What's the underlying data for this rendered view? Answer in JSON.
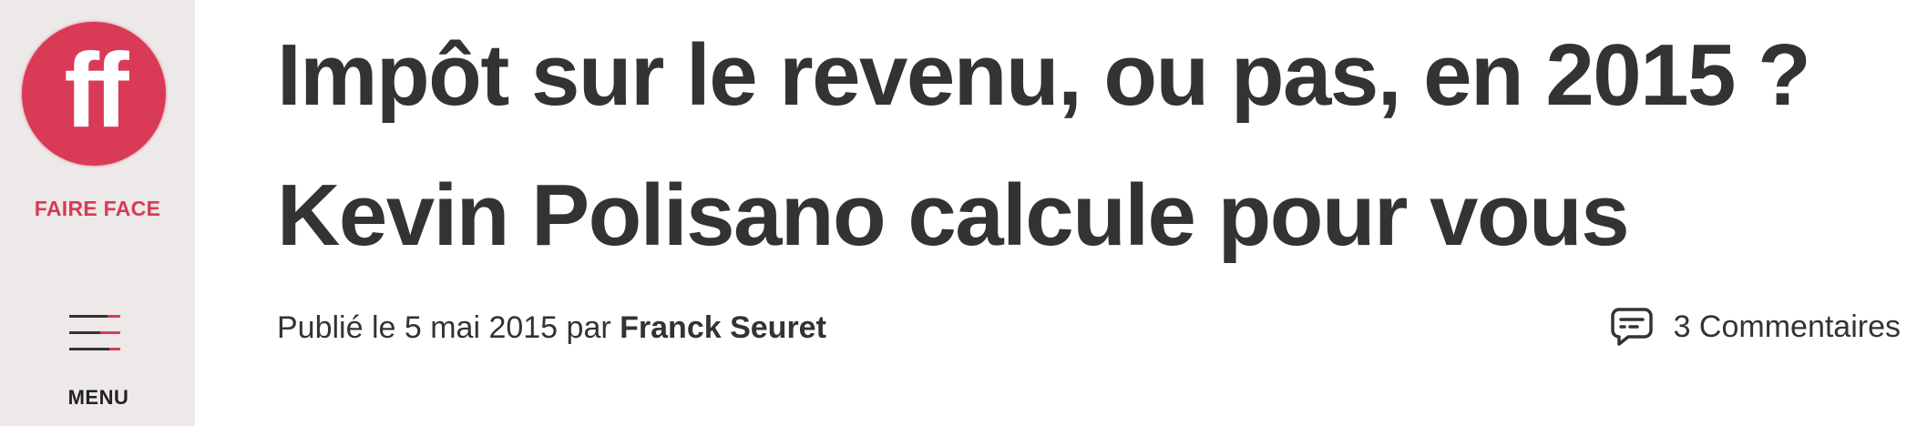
{
  "brand": {
    "logo_text": "ff",
    "name": "FAIRE FACE",
    "accent": "#d93a56"
  },
  "nav": {
    "menu_label": "MENU",
    "menu_icon": "hamburger-icon"
  },
  "article": {
    "title_line1": "Impôt sur le revenu, ou pas, en 2015 ?",
    "title_line2": "Kevin Polisano calcule pour vous",
    "published_prefix": "Publié le 5 mai 2015 par",
    "author": "Franck Seuret",
    "comments_icon": "comment-icon",
    "comments_label": "3 Commentaires"
  },
  "colors": {
    "sidebar_bg": "#ece9e8",
    "text": "#333333"
  }
}
